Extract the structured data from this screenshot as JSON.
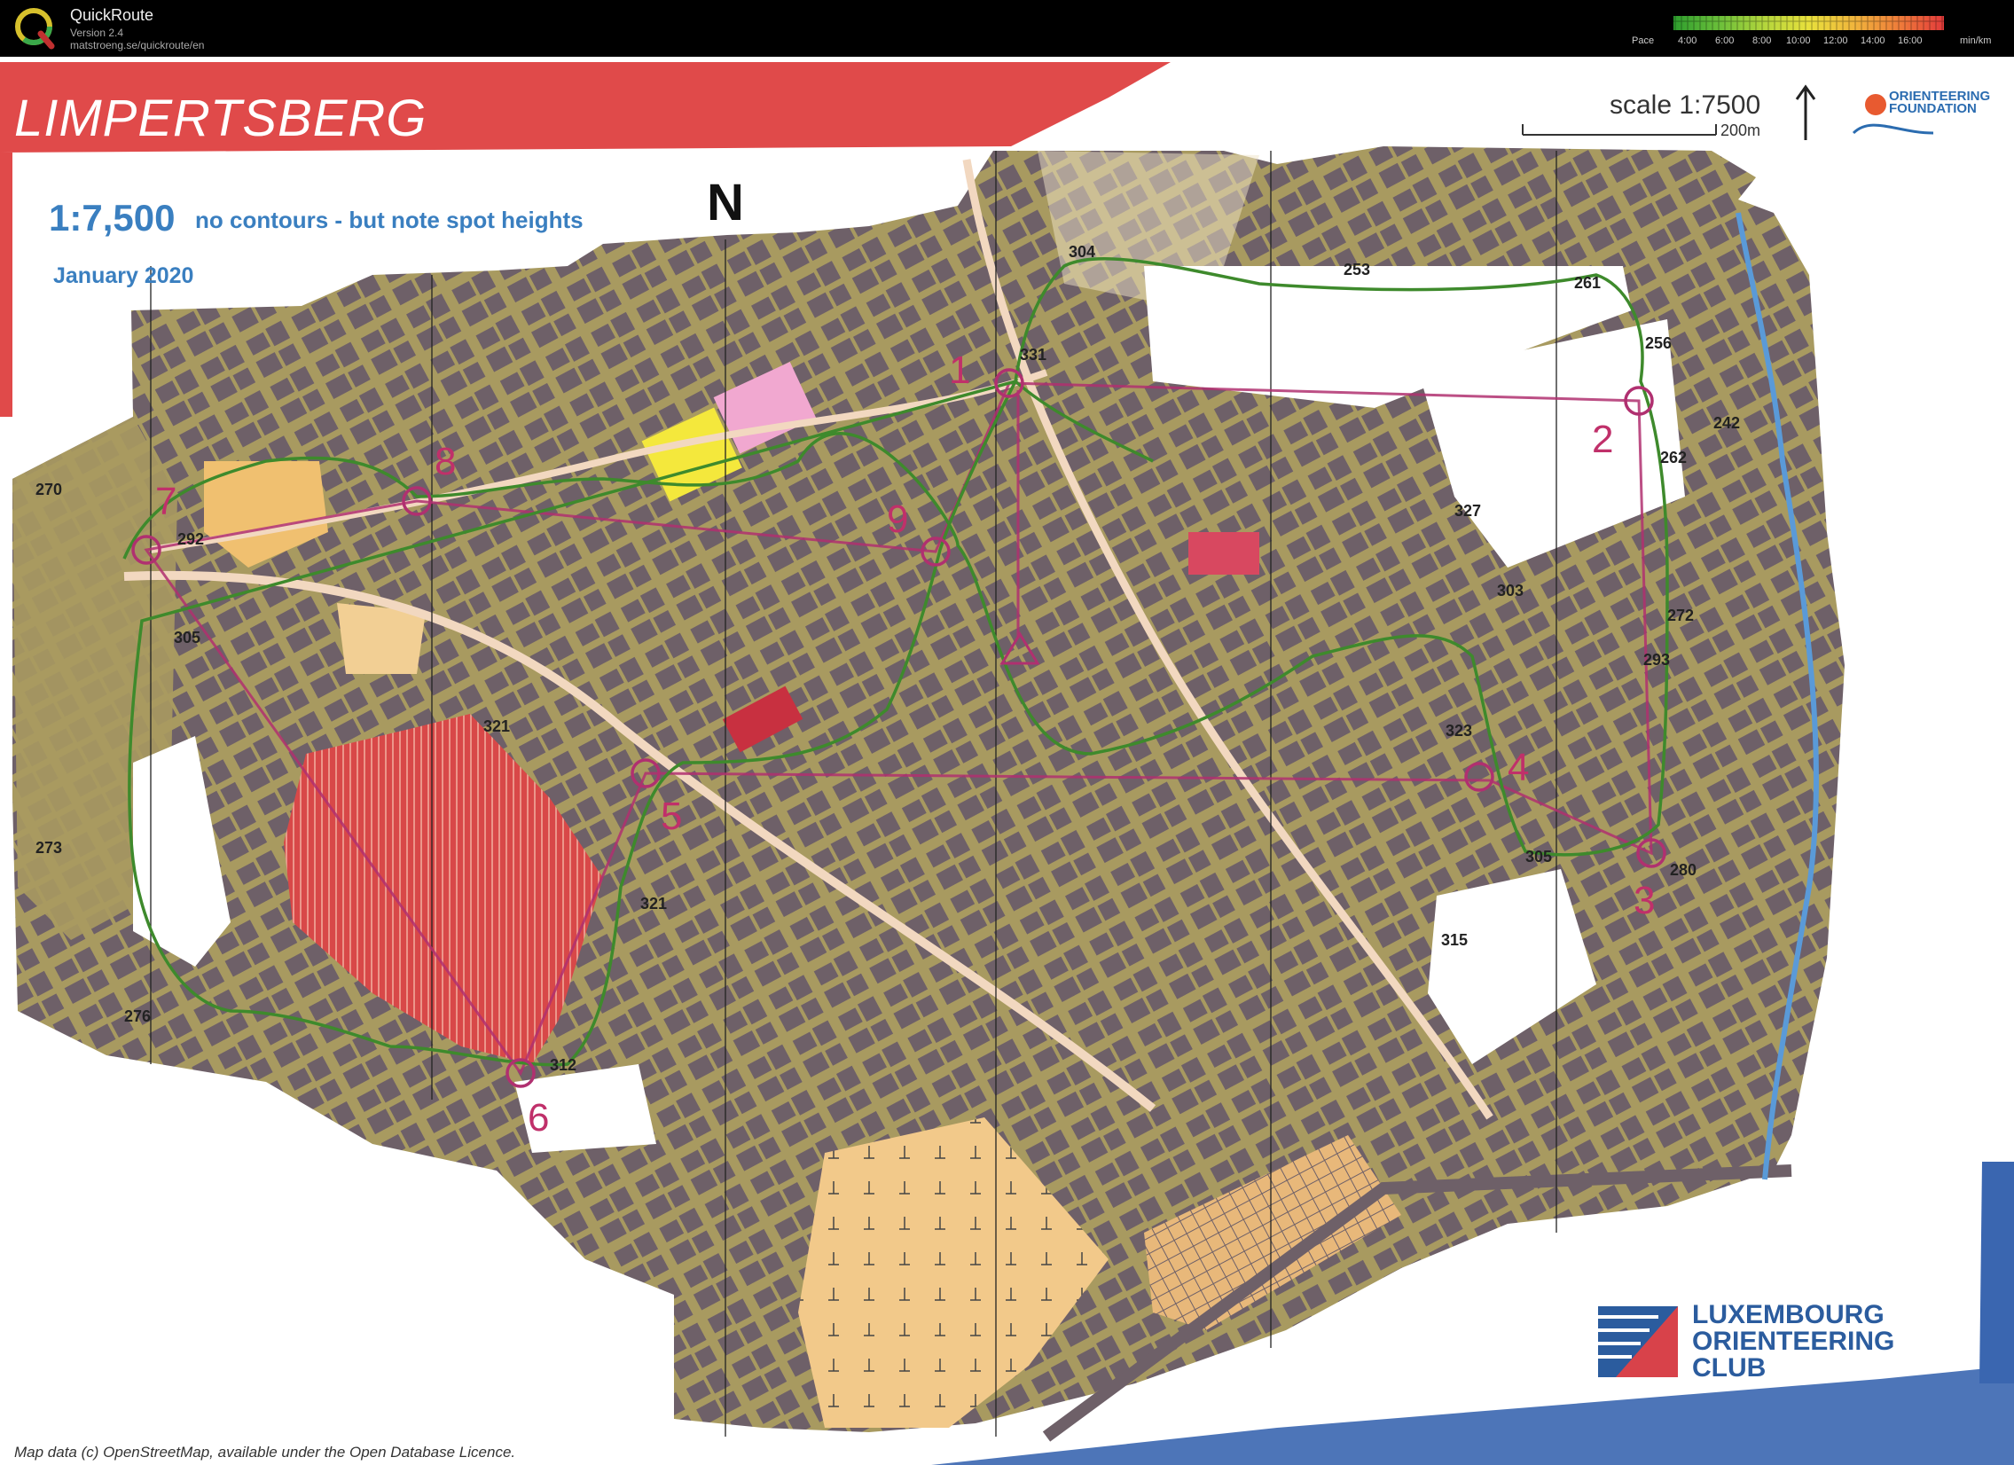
{
  "app": {
    "name": "QuickRoute",
    "version": "Version 2.4",
    "url": "matstroeng.se/quickroute/en"
  },
  "pace_legend": {
    "label": "Pace",
    "ticks": [
      "4:00",
      "6:00",
      "8:00",
      "10:00",
      "12:00",
      "14:00",
      "16:00"
    ],
    "unit": "min/km",
    "colors": [
      "#2e9e2e",
      "#6bbf3a",
      "#b5d63c",
      "#e8e03c",
      "#f0b43c",
      "#ee7a3a",
      "#e33b3b"
    ]
  },
  "map": {
    "title": "LIMPERTSBERG",
    "scale_label": "scale 1:7500",
    "scale_bar_label": "200m",
    "scale_text": "1:7,500",
    "note": "no contours - but note spot heights",
    "date": "January 2020",
    "north_label": "N",
    "copyright": "Map data (c) OpenStreetMap, available under the Open Database Licence.",
    "club_name": [
      "LUXEMBOURG",
      "ORIENTEERING",
      "CLUB"
    ],
    "foundation_name": [
      "ORIENTEERING",
      "FOUNDATION"
    ],
    "colors": {
      "terrain": "#a89a60",
      "buildings": "#6e6068",
      "open_land": "#f0c070",
      "course": "#b03070",
      "route": "#3e8a2c",
      "out_of_bounds": "#d84848",
      "water": "#5a9ad8"
    },
    "controls": [
      "1",
      "2",
      "3",
      "4",
      "5",
      "6",
      "7",
      "8",
      "9"
    ],
    "spot_heights": [
      "304",
      "331",
      "253",
      "261",
      "256",
      "242",
      "262",
      "327",
      "303",
      "272",
      "293",
      "323",
      "305",
      "280",
      "315",
      "270",
      "292",
      "305",
      "321",
      "273",
      "321",
      "276",
      "312"
    ]
  }
}
